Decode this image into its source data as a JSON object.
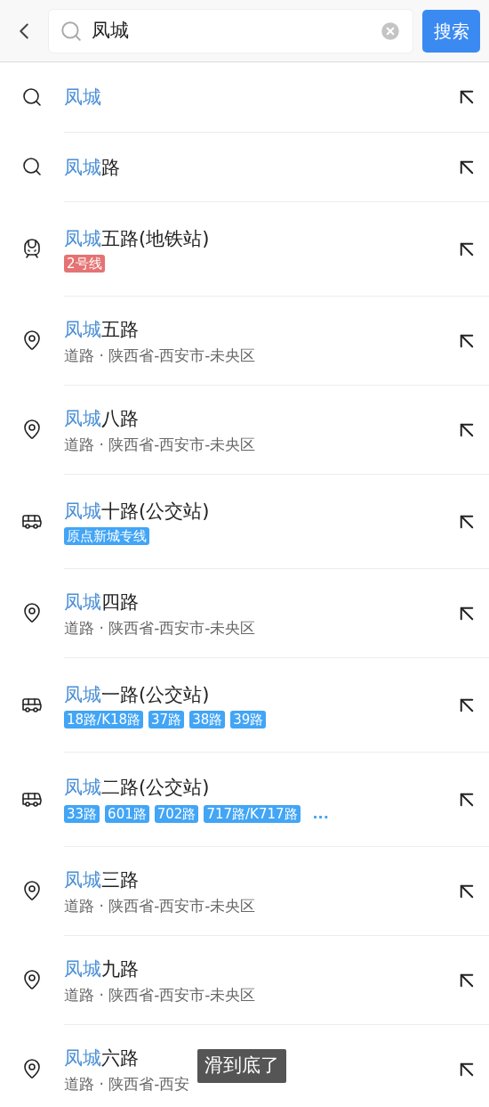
{
  "search_bar": {
    "value": "凤城",
    "button": "搜索"
  },
  "suggestions": [
    {
      "kind": "query",
      "match": "凤城"
    },
    {
      "kind": "query",
      "match": "凤城",
      "rest": "路"
    },
    {
      "kind": "metro",
      "match": "凤城",
      "rest": "五路(地铁站)",
      "tags": [
        {
          "text": "2号线",
          "color": "#e57373"
        }
      ]
    },
    {
      "kind": "place",
      "match": "凤城",
      "rest": "五路",
      "subtitle": "道路 · 陕西省-西安市-未央区"
    },
    {
      "kind": "place",
      "match": "凤城",
      "rest": "八路",
      "subtitle": "道路 · 陕西省-西安市-未央区"
    },
    {
      "kind": "bus",
      "match": "凤城",
      "rest": "十路(公交站)",
      "tags": [
        {
          "text": "原点新城专线",
          "color": "#42a5f5"
        }
      ]
    },
    {
      "kind": "place",
      "match": "凤城",
      "rest": "四路",
      "subtitle": "道路 · 陕西省-西安市-未央区"
    },
    {
      "kind": "bus",
      "match": "凤城",
      "rest": "一路(公交站)",
      "tags": [
        {
          "text": "18路/K18路",
          "color": "#42a5f5"
        },
        {
          "text": "37路",
          "color": "#42a5f5"
        },
        {
          "text": "38路",
          "color": "#42a5f5"
        },
        {
          "text": "39路",
          "color": "#42a5f5"
        }
      ]
    },
    {
      "kind": "bus",
      "match": "凤城",
      "rest": "二路(公交站)",
      "tags": [
        {
          "text": "33路",
          "color": "#42a5f5"
        },
        {
          "text": "601路",
          "color": "#42a5f5"
        },
        {
          "text": "702路",
          "color": "#42a5f5"
        },
        {
          "text": "717路/K717路",
          "color": "#42a5f5"
        }
      ],
      "more": "..."
    },
    {
      "kind": "place",
      "match": "凤城",
      "rest": "三路",
      "subtitle": "道路 · 陕西省-西安市-未央区"
    },
    {
      "kind": "place",
      "match": "凤城",
      "rest": "九路",
      "subtitle": "道路 · 陕西省-西安市-未央区"
    },
    {
      "kind": "place",
      "match": "凤城",
      "rest": "六路",
      "subtitle": "道路 · 陕西省-西安"
    }
  ],
  "toast": "滑到底了"
}
